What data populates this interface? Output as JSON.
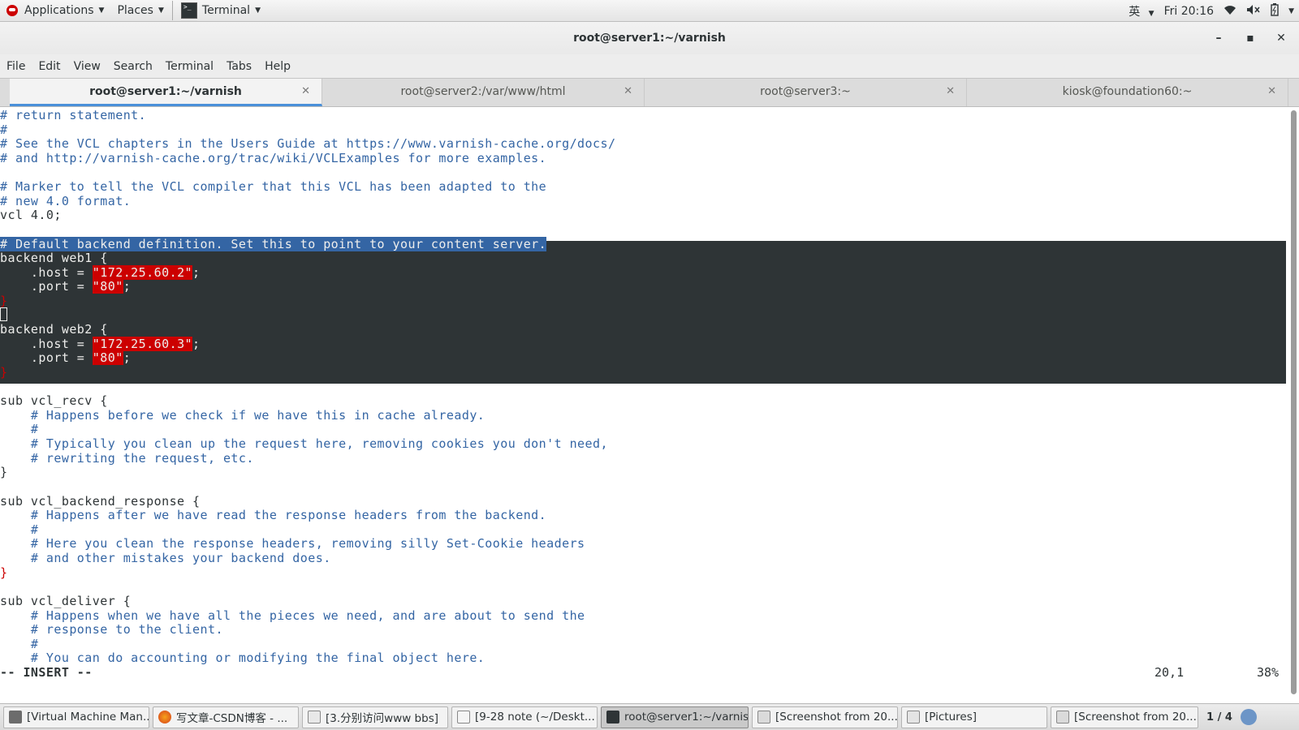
{
  "panel": {
    "applications": "Applications",
    "places": "Places",
    "terminal": "Terminal",
    "input_method": "英",
    "clock": "Fri 20:16"
  },
  "window": {
    "title": "root@server1:~/varnish",
    "menu": [
      "File",
      "Edit",
      "View",
      "Search",
      "Terminal",
      "Tabs",
      "Help"
    ]
  },
  "tabs": [
    {
      "label": "root@server1:~/varnish",
      "active": true
    },
    {
      "label": "root@server2:/var/www/html",
      "active": false
    },
    {
      "label": "root@server3:~",
      "active": false
    },
    {
      "label": "kiosk@foundation60:~",
      "active": false
    }
  ],
  "editor": {
    "lines": {
      "l1": "# return statement.",
      "l2": "#",
      "l3": "# See the VCL chapters in the Users Guide at https://www.varnish-cache.org/docs/",
      "l4": "# and http://varnish-cache.org/trac/wiki/VCLExamples for more examples.",
      "l6": "# Marker to tell the VCL compiler that this VCL has been adapted to the",
      "l7": "# new 4.0 format.",
      "l8": "vcl 4.0;",
      "l10": "# Default backend definition. Set this to point to your content server.",
      "l11": "backend web1 {",
      "l12a": "    .host = ",
      "l12s": "\"172.25.60.2\"",
      "l13a": "    .port = ",
      "l13s": "\"80\"",
      "l14": "}",
      "l16": "backend web2 {",
      "l17a": "    .host = ",
      "l17s": "\"172.25.60.3\"",
      "l18a": "    .port = ",
      "l18s": "\"80\"",
      "l19": "}",
      "l21": "sub vcl_recv {",
      "l22": "    # Happens before we check if we have this in cache already.",
      "l23": "    #",
      "l24": "    # Typically you clean up the request here, removing cookies you don't need,",
      "l25": "    # rewriting the request, etc.",
      "l26": "}",
      "l28": "sub vcl_backend_response {",
      "l29": "    # Happens after we have read the response headers from the backend.",
      "l30": "    #",
      "l31": "    # Here you clean the response headers, removing silly Set-Cookie headers",
      "l32": "    # and other mistakes your backend does.",
      "l33": "}",
      "l35": "sub vcl_deliver {",
      "l36": "    # Happens when we have all the pieces we need, and are about to send the",
      "l37": "    # response to the client.",
      "l38": "    #",
      "l39": "    # You can do accounting or modifying the final object here."
    },
    "mode": "-- INSERT --",
    "cursor_pos": "20,1",
    "percent": "38%"
  },
  "taskbar": {
    "items": [
      "[Virtual Machine Man...",
      "写文章-CSDN博客 - ...",
      "[3.分别访问www bbs]",
      "[9-28 note (~/Deskt...",
      "root@server1:~/varnish",
      "[Screenshot from 20...",
      "[Pictures]",
      "[Screenshot from 20..."
    ],
    "workspace": "1 / 4"
  },
  "colors": {
    "comment": "#3465a4",
    "string_bg": "#cc0000",
    "selection_bg": "#3465a4",
    "visual_block_bg": "#2e3436",
    "tab_active_underline": "#4a90d9"
  },
  "icons": [
    "fedora-icon",
    "terminal-icon",
    "wifi-icon",
    "volume-icon",
    "battery-icon",
    "power-icon"
  ]
}
